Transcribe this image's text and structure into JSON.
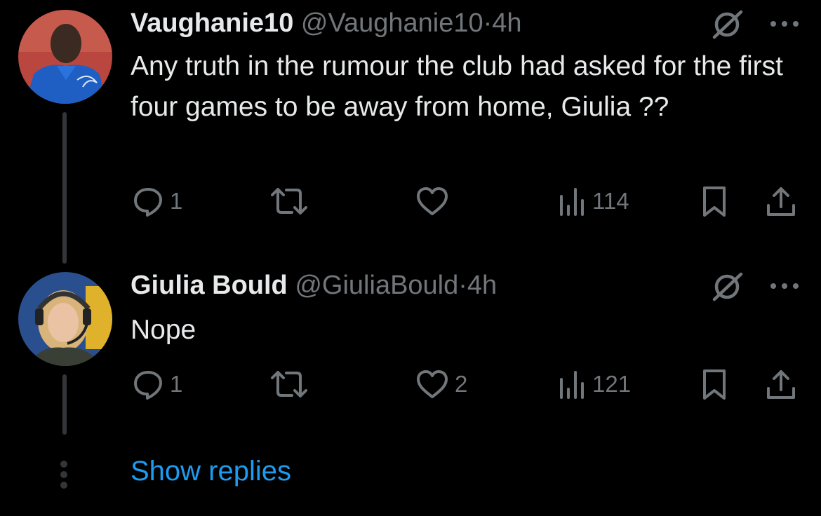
{
  "tweets": [
    {
      "name": "Vaughanie10",
      "handle": "@Vaughanie10",
      "sep": "·",
      "time": "4h",
      "text": "Any truth in the rumour the club had asked for the first four games to be away from home, Giulia  ??",
      "replies": "1",
      "retweets": "",
      "likes": "",
      "views": "114"
    },
    {
      "name": "Giulia Bould",
      "handle": "@GiuliaBould",
      "sep": "·",
      "time": "4h",
      "text": "Nope",
      "replies": "1",
      "retweets": "",
      "likes": "2",
      "views": "121"
    }
  ],
  "show_replies": "Show replies",
  "colors": {
    "background": "#000000",
    "text": "#e7e9ea",
    "muted": "#71767b",
    "link": "#1d9bf0",
    "thread": "#333639"
  },
  "icons": [
    "grok-icon",
    "more-icon",
    "reply-icon",
    "retweet-icon",
    "like-icon",
    "views-icon",
    "bookmark-icon",
    "share-icon"
  ]
}
